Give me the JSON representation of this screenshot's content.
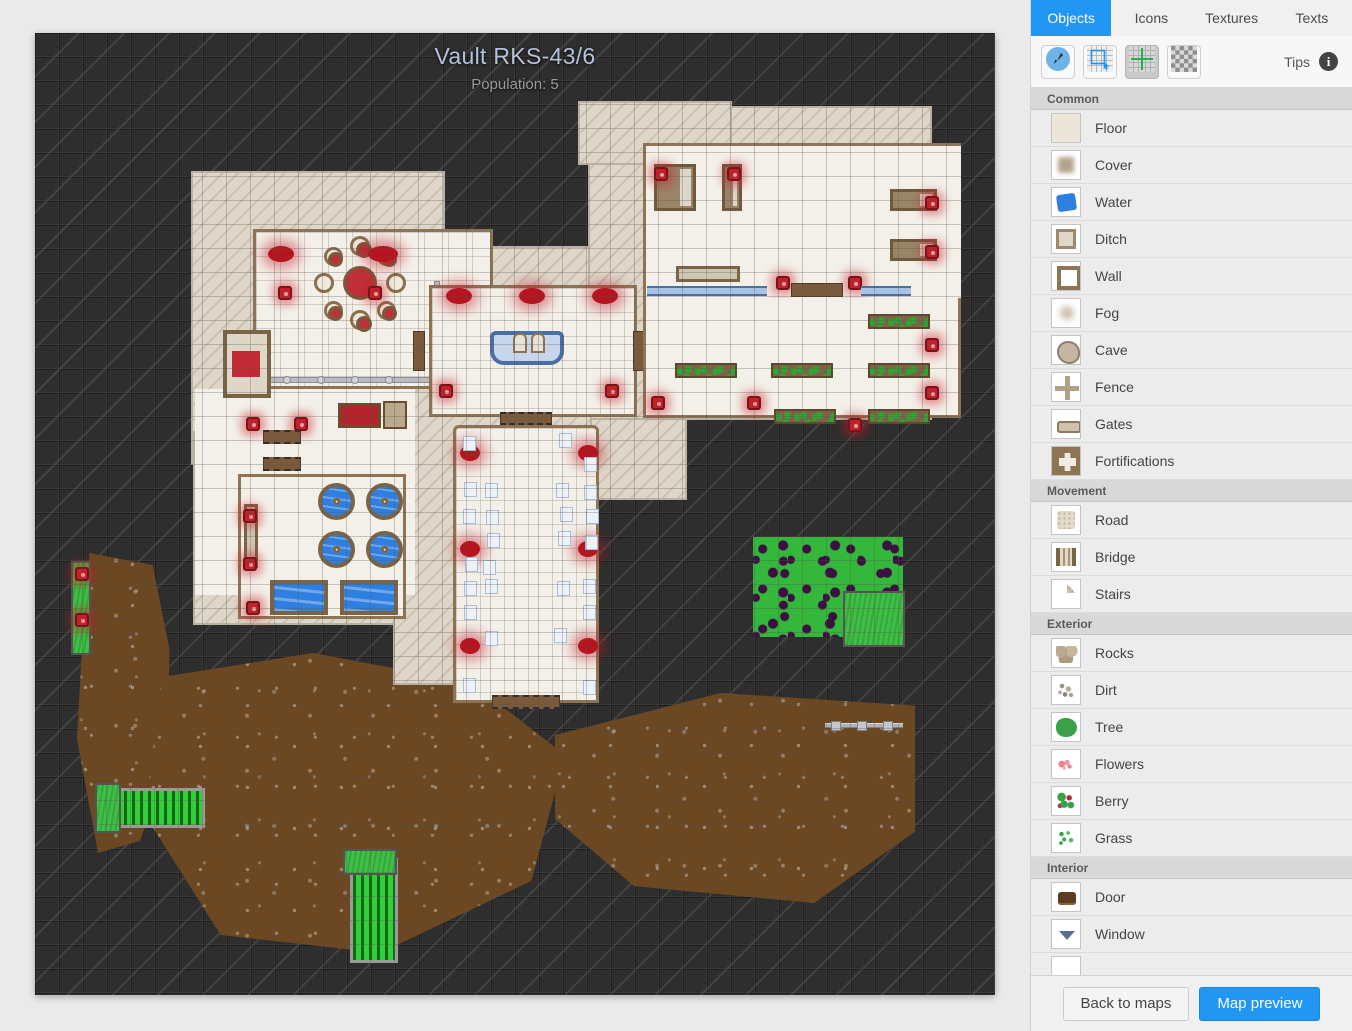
{
  "map": {
    "title": "Vault RKS-43/6",
    "population_label": "Population: 5"
  },
  "panel": {
    "tabs": [
      {
        "label": "Objects",
        "active": true
      },
      {
        "label": "Icons",
        "active": false
      },
      {
        "label": "Textures",
        "active": false
      },
      {
        "label": "Texts",
        "active": false
      }
    ],
    "toolbar": {
      "buttons": [
        {
          "name": "brush-tool",
          "icon": "brush-icon",
          "pressed": false
        },
        {
          "name": "select-tool",
          "icon": "rectangle-select-icon",
          "pressed": false
        },
        {
          "name": "grid-tool",
          "icon": "grid-crosshair-icon",
          "pressed": true
        },
        {
          "name": "transparency-tool",
          "icon": "checkerboard-icon",
          "pressed": false
        }
      ],
      "tips_label": "Tips",
      "info_glyph": "i"
    },
    "groups": [
      {
        "name": "Common",
        "items": [
          {
            "label": "Floor",
            "icon": "floor-swatch"
          },
          {
            "label": "Cover",
            "icon": "cover-swatch"
          },
          {
            "label": "Water",
            "icon": "water-swatch"
          },
          {
            "label": "Ditch",
            "icon": "ditch-swatch"
          },
          {
            "label": "Wall",
            "icon": "wall-swatch"
          },
          {
            "label": "Fog",
            "icon": "fog-swatch"
          },
          {
            "label": "Cave",
            "icon": "cave-swatch"
          },
          {
            "label": "Fence",
            "icon": "fence-swatch"
          },
          {
            "label": "Gates",
            "icon": "gates-swatch"
          },
          {
            "label": "Fortifications",
            "icon": "fortifications-swatch"
          }
        ]
      },
      {
        "name": "Movement",
        "items": [
          {
            "label": "Road",
            "icon": "road-swatch"
          },
          {
            "label": "Bridge",
            "icon": "bridge-swatch"
          },
          {
            "label": "Stairs",
            "icon": "stairs-swatch"
          }
        ]
      },
      {
        "name": "Exterior",
        "items": [
          {
            "label": "Rocks",
            "icon": "rocks-swatch"
          },
          {
            "label": "Dirt",
            "icon": "dirt-swatch"
          },
          {
            "label": "Tree",
            "icon": "tree-swatch"
          },
          {
            "label": "Flowers",
            "icon": "flowers-swatch"
          },
          {
            "label": "Berry",
            "icon": "berry-swatch"
          },
          {
            "label": "Grass",
            "icon": "grass-swatch"
          }
        ]
      },
      {
        "name": "Interior",
        "items": [
          {
            "label": "Door",
            "icon": "door-swatch"
          },
          {
            "label": "Window",
            "icon": "window-swatch"
          }
        ]
      }
    ],
    "footer": {
      "back_label": "Back to maps",
      "preview_label": "Map preview"
    }
  },
  "colors": {
    "accent": "#2196f3",
    "panel_bg": "#f0f0f0",
    "list_bg": "#ececec",
    "group_header_bg": "#d8d8d8",
    "map_fog": "#2e2e2e",
    "map_floor": "#f3f0e9",
    "map_wall": "#8d7455",
    "map_title": "#b3c2da",
    "map_population": "#9a9a9a",
    "water": "#2e7fe0",
    "grass": "#34b83c",
    "dirt": "#6b4722",
    "berry": "#3c1142"
  }
}
